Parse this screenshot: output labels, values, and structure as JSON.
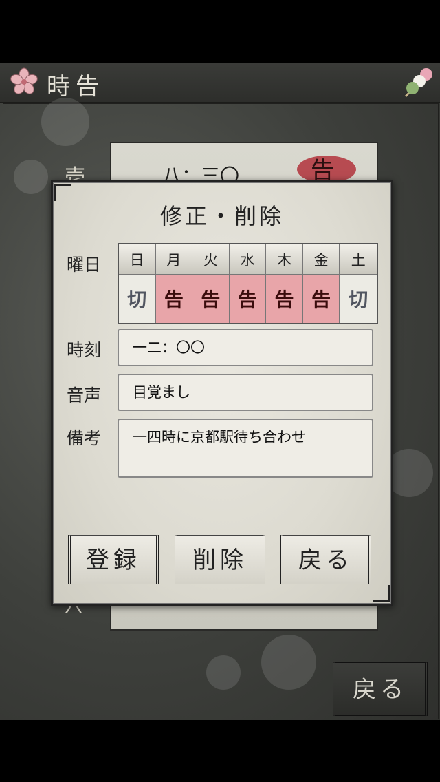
{
  "header": {
    "title": "時告"
  },
  "background": {
    "side_glyph": "壱",
    "time": "八：三〇",
    "tag": "告",
    "bottom_glyph": "六"
  },
  "dialog": {
    "title": "修正・削除",
    "weekday_label": "曜日",
    "days": [
      {
        "name": "日",
        "state": "切",
        "active": false
      },
      {
        "name": "月",
        "state": "告",
        "active": true
      },
      {
        "name": "火",
        "state": "告",
        "active": true
      },
      {
        "name": "水",
        "state": "告",
        "active": true
      },
      {
        "name": "木",
        "state": "告",
        "active": true
      },
      {
        "name": "金",
        "state": "告",
        "active": true
      },
      {
        "name": "土",
        "state": "切",
        "active": false
      }
    ],
    "time_label": "時刻",
    "time_value": "一二：〇〇",
    "voice_label": "音声",
    "voice_value": "目覚まし",
    "note_label": "備考",
    "note_value": "一四時に京都駅待ち合わせ",
    "buttons": {
      "register": "登録",
      "delete": "削除",
      "back": "戻る"
    }
  },
  "footer": {
    "back": "戻る"
  },
  "colors": {
    "active_day": "#e8a5a9",
    "inactive_day": "#ecebe4"
  }
}
